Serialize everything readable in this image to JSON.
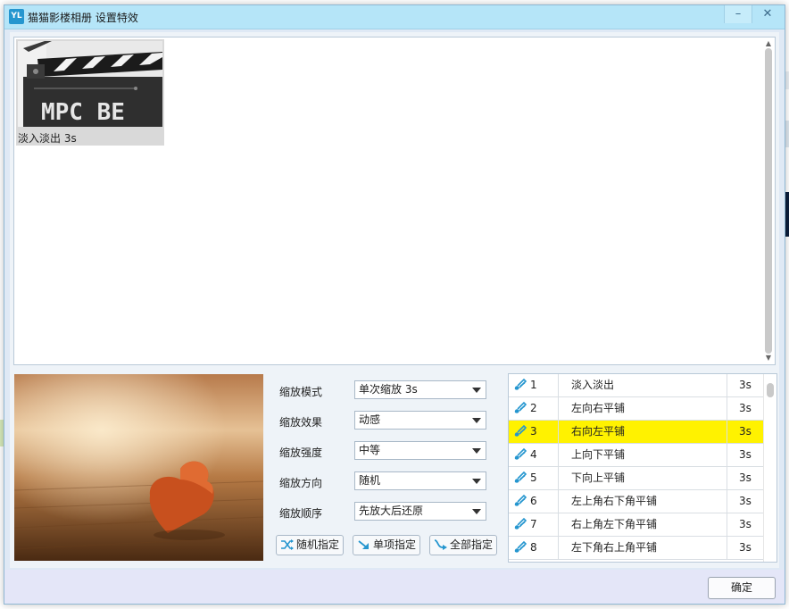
{
  "window": {
    "app_icon_text": "YL",
    "title": "猫猫影楼相册 设置特效",
    "minimize_glyph": "–",
    "close_glyph": "✕"
  },
  "thumbnail": {
    "image_text": "MPC BE",
    "caption": "淡入淡出 3s"
  },
  "controls": [
    {
      "label": "缩放模式",
      "value": "单次缩放 3s"
    },
    {
      "label": "缩放效果",
      "value": "动感"
    },
    {
      "label": "缩放强度",
      "value": "中等"
    },
    {
      "label": "缩放方向",
      "value": "随机"
    },
    {
      "label": "缩放顺序",
      "value": "先放大后还原"
    }
  ],
  "actions": {
    "random": "随机指定",
    "single": "单项指定",
    "all": "全部指定"
  },
  "effects": {
    "selected_index": 2,
    "rows": [
      {
        "num": "1",
        "name": "淡入淡出",
        "duration": "3s"
      },
      {
        "num": "2",
        "name": "左向右平铺",
        "duration": "3s"
      },
      {
        "num": "3",
        "name": "右向左平铺",
        "duration": "3s"
      },
      {
        "num": "4",
        "name": "上向下平铺",
        "duration": "3s"
      },
      {
        "num": "5",
        "name": "下向上平铺",
        "duration": "3s"
      },
      {
        "num": "6",
        "name": "左上角右下角平铺",
        "duration": "3s"
      },
      {
        "num": "7",
        "name": "右上角左下角平铺",
        "duration": "3s"
      },
      {
        "num": "8",
        "name": "左下角右上角平铺",
        "duration": "3s"
      }
    ]
  },
  "footer": {
    "ok_label": "确定"
  },
  "colors": {
    "selected_row": "#fff200",
    "titlebar": "#b5e5f8",
    "icon_accent": "#2596cf"
  },
  "icons": {
    "effect_row": "brush-icon",
    "random": "shuffle-icon",
    "single": "arrow-down-right-icon",
    "all": "curve-arrow-icon"
  }
}
